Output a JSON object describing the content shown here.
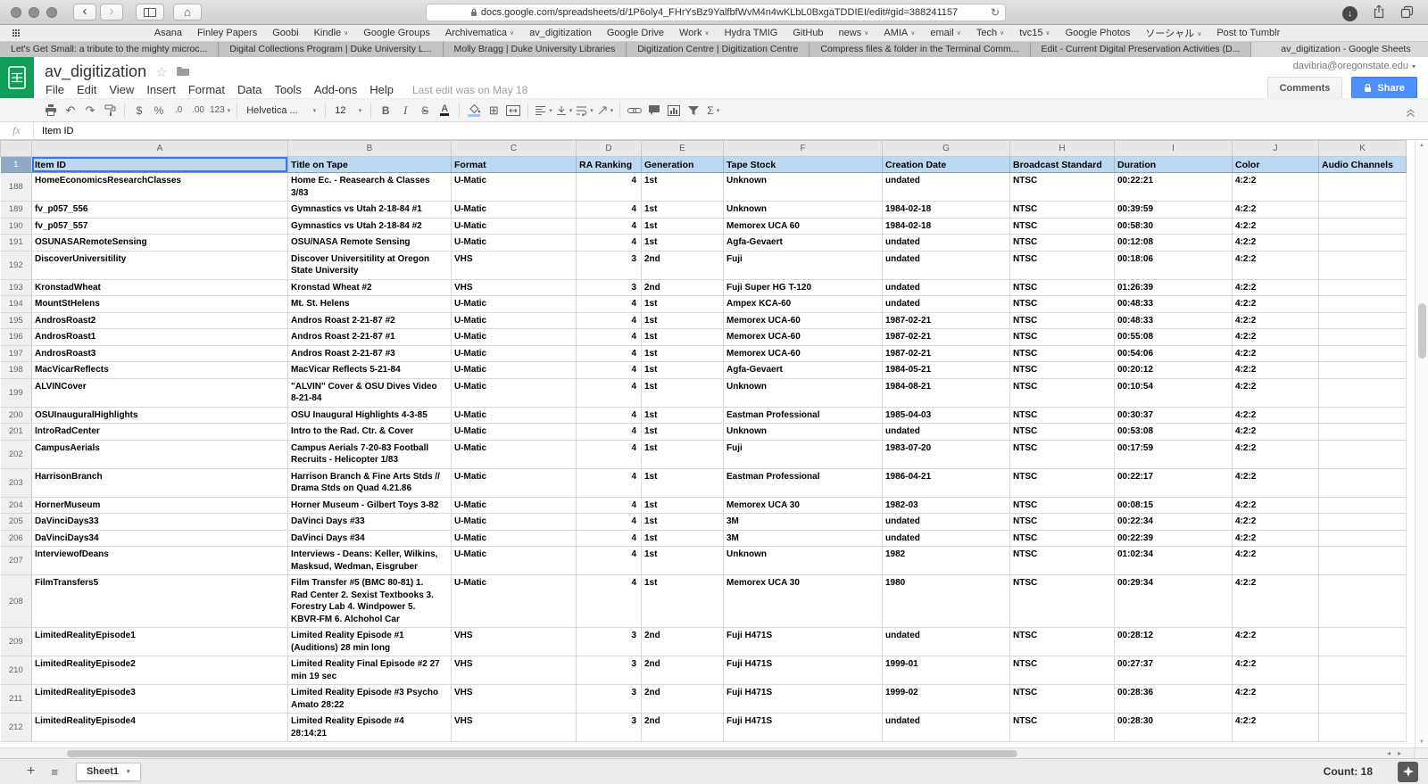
{
  "icons": {
    "back": "‹",
    "forward": "›",
    "home": "⌂",
    "refresh": "↻",
    "download_arrow": "↓",
    "undo": "↶",
    "redo": "↷",
    "borders": "⊞",
    "sigma": "Σ",
    "hamburger": "≡",
    "star_outline": "☆",
    "chevron_down": "▾",
    "bookmark_caret": "∨",
    "scroll_up": "▲",
    "scroll_down": "▼",
    "scroll_left": "◂",
    "scroll_right": "▸"
  },
  "colors": {
    "share_button": "#4d90fe",
    "sheets_green": "#0f9d58",
    "header_row_fill": "#bdd9f1",
    "selection_border": "#3b78e7"
  },
  "browser": {
    "url": "docs.google.com/spreadsheets/d/1P6oly4_FHrYsBz9YalfbfWvM4n4wKLbL0BxgaTDDIEI/edit#gid=388241157",
    "new_tab": "+",
    "bookmarks": [
      {
        "label": "Asana"
      },
      {
        "label": "Finley Papers"
      },
      {
        "label": "Goobi"
      },
      {
        "label": "Kindle",
        "dd": true
      },
      {
        "label": "Google Groups"
      },
      {
        "label": "Archivematica",
        "dd": true
      },
      {
        "label": "av_digitization"
      },
      {
        "label": "Google Drive"
      },
      {
        "label": "Work",
        "dd": true
      },
      {
        "label": "Hydra TMIG"
      },
      {
        "label": "GitHub"
      },
      {
        "label": "news",
        "dd": true
      },
      {
        "label": "AMIA",
        "dd": true
      },
      {
        "label": "email",
        "dd": true
      },
      {
        "label": "Tech",
        "dd": true
      },
      {
        "label": "tvc15",
        "dd": true
      },
      {
        "label": "Google Photos"
      },
      {
        "label": "ソーシャル",
        "dd": true
      },
      {
        "label": "Post to Tumblr"
      }
    ],
    "tabs": [
      {
        "title": "Let's Get Small: a tribute to the mighty microc...",
        "active": false
      },
      {
        "title": "Digital Collections Program | Duke University L...",
        "active": false
      },
      {
        "title": "Molly Bragg | Duke University Libraries",
        "active": false
      },
      {
        "title": "Digitization Centre | Digitization Centre",
        "active": false
      },
      {
        "title": "Compress files & folder in the Terminal Comm...",
        "active": false
      },
      {
        "title": "Edit - Current Digital Preservation Activities (D...",
        "active": false
      },
      {
        "title": "av_digitization - Google Sheets",
        "active": true
      }
    ]
  },
  "header": {
    "title": "av_digitization",
    "menus": [
      "File",
      "Edit",
      "View",
      "Insert",
      "Format",
      "Data",
      "Tools",
      "Add-ons",
      "Help"
    ],
    "last_edit": "Last edit was on May 18",
    "account": "davibria@oregonstate.edu",
    "comments": "Comments",
    "share": "Share"
  },
  "toolbar": {
    "currency": "$",
    "percent": "%",
    "decimals_decrease": ".0",
    "decimals_increase": ".00",
    "more_formats": "123",
    "font": "Helvetica ...",
    "size": "12",
    "bold": "B",
    "italic": "I",
    "strikethrough": "S",
    "text_color": "A",
    "functions": "Σ"
  },
  "formula_bar": {
    "label": "fx",
    "value": "Item ID"
  },
  "sheet": {
    "column_letters": [
      "A",
      "B",
      "C",
      "D",
      "E",
      "F",
      "G",
      "H",
      "I",
      "J",
      "K"
    ],
    "frozen_row": {
      "number": "1",
      "cells": [
        "Item ID",
        "Title on Tape",
        "Format",
        "RA Ranking",
        "Generation",
        "Tape Stock",
        "Creation Date",
        "Broadcast Standard",
        "Duration",
        "Color",
        "Audio Channels"
      ]
    },
    "rows": [
      [
        "188",
        "HomeEconomicsResearchClasses",
        "Home Ec. - Reasearch & Classes\n3/83",
        "U-Matic",
        "4",
        "1st",
        "Unknown",
        "undated",
        "NTSC",
        "00:22:21",
        "4:2:2",
        ""
      ],
      [
        "189",
        "fv_p057_556",
        "Gymnastics vs Utah 2-18-84 #1",
        "U-Matic",
        "4",
        "1st",
        "Unknown",
        "1984-02-18",
        "NTSC",
        "00:39:59",
        "4:2:2",
        ""
      ],
      [
        "190",
        "fv_p057_557",
        "Gymnastics vs Utah 2-18-84 #2",
        "U-Matic",
        "4",
        "1st",
        "Memorex UCA 60",
        "1984-02-18",
        "NTSC",
        "00:58:30",
        "4:2:2",
        ""
      ],
      [
        "191",
        "OSUNASARemoteSensing",
        "OSU/NASA Remote Sensing",
        "U-Matic",
        "4",
        "1st",
        "Agfa-Gevaert",
        "undated",
        "NTSC",
        "00:12:08",
        "4:2:2",
        ""
      ],
      [
        "192",
        "DiscoverUniversitility",
        "Discover Universitility at Oregon\nState University",
        "VHS",
        "3",
        "2nd",
        "Fuji",
        "undated",
        "NTSC",
        "00:18:06",
        "4:2:2",
        ""
      ],
      [
        "193",
        "KronstadWheat",
        "Kronstad Wheat #2",
        "VHS",
        "3",
        "2nd",
        "Fuji Super HG T-120",
        "undated",
        "NTSC",
        "01:26:39",
        "4:2:2",
        ""
      ],
      [
        "194",
        "MountStHelens",
        "Mt. St. Helens",
        "U-Matic",
        "4",
        "1st",
        "Ampex KCA-60",
        "undated",
        "NTSC",
        "00:48:33",
        "4:2:2",
        ""
      ],
      [
        "195",
        "AndrosRoast2",
        "Andros Roast 2-21-87 #2",
        "U-Matic",
        "4",
        "1st",
        "Memorex UCA-60",
        "1987-02-21",
        "NTSC",
        "00:48:33",
        "4:2:2",
        ""
      ],
      [
        "196",
        "AndrosRoast1",
        "Andros Roast 2-21-87 #1",
        "U-Matic",
        "4",
        "1st",
        "Memorex UCA-60",
        "1987-02-21",
        "NTSC",
        "00:55:08",
        "4:2:2",
        ""
      ],
      [
        "197",
        "AndrosRoast3",
        "Andros Roast 2-21-87 #3",
        "U-Matic",
        "4",
        "1st",
        "Memorex UCA-60",
        "1987-02-21",
        "NTSC",
        "00:54:06",
        "4:2:2",
        ""
      ],
      [
        "198",
        "MacVicarReflects",
        "MacVicar Reflects 5-21-84",
        "U-Matic",
        "4",
        "1st",
        "Agfa-Gevaert",
        "1984-05-21",
        "NTSC",
        "00:20:12",
        "4:2:2",
        ""
      ],
      [
        "199",
        "ALVINCover",
        "\"ALVIN\" Cover & OSU Dives Video\n8-21-84",
        "U-Matic",
        "4",
        "1st",
        "Unknown",
        "1984-08-21",
        "NTSC",
        "00:10:54",
        "4:2:2",
        ""
      ],
      [
        "200",
        "OSUInauguralHighlights",
        "OSU Inaugural Highlights 4-3-85",
        "U-Matic",
        "4",
        "1st",
        "Eastman Professional",
        "1985-04-03",
        "NTSC",
        "00:30:37",
        "4:2:2",
        ""
      ],
      [
        "201",
        "IntroRadCenter",
        "Intro to the Rad. Ctr. & Cover",
        "U-Matic",
        "4",
        "1st",
        "Unknown",
        "undated",
        "NTSC",
        "00:53:08",
        "4:2:2",
        ""
      ],
      [
        "202",
        "CampusAerials",
        "Campus Aerials 7-20-83 Football\nRecruits - Helicopter 1/83",
        "U-Matic",
        "4",
        "1st",
        "Fuji",
        "1983-07-20",
        "NTSC",
        "00:17:59",
        "4:2:2",
        ""
      ],
      [
        "203",
        "HarrisonBranch",
        "Harrison Branch & Fine Arts Stds //\nDrama Stds on Quad 4.21.86",
        "U-Matic",
        "4",
        "1st",
        "Eastman Professional",
        "1986-04-21",
        "NTSC",
        "00:22:17",
        "4:2:2",
        ""
      ],
      [
        "204",
        "HornerMuseum",
        "Horner Museum - Gilbert Toys 3-82",
        "U-Matic",
        "4",
        "1st",
        "Memorex UCA 30",
        "1982-03",
        "NTSC",
        "00:08:15",
        "4:2:2",
        ""
      ],
      [
        "205",
        "DaVinciDays33",
        "DaVinci Days #33",
        "U-Matic",
        "4",
        "1st",
        "3M",
        "undated",
        "NTSC",
        "00:22:34",
        "4:2:2",
        ""
      ],
      [
        "206",
        "DaVinciDays34",
        "DaVinci Days #34",
        "U-Matic",
        "4",
        "1st",
        "3M",
        "undated",
        "NTSC",
        "00:22:39",
        "4:2:2",
        ""
      ],
      [
        "207",
        "InterviewofDeans",
        "Interviews - Deans: Keller, Wilkins,\nMasksud, Wedman, Eisgruber",
        "U-Matic",
        "4",
        "1st",
        "Unknown",
        "1982",
        "NTSC",
        "01:02:34",
        "4:2:2",
        ""
      ],
      [
        "208",
        "FilmTransfers5",
        "Film Transfer #5 (BMC 80-81) 1.\nRad Center 2. Sexist Textbooks 3.\nForestry Lab 4. Windpower 5.\nKBVR-FM 6. Alchohol Car",
        "U-Matic",
        "4",
        "1st",
        "Memorex UCA 30",
        "1980",
        "NTSC",
        "00:29:34",
        "4:2:2",
        ""
      ],
      [
        "209",
        "LimitedRealityEpisode1",
        "Limited Reality Episode #1\n(Auditions) 28 min long",
        "VHS",
        "3",
        "2nd",
        "Fuji H471S",
        "undated",
        "NTSC",
        "00:28:12",
        "4:2:2",
        ""
      ],
      [
        "210",
        "LimitedRealityEpisode2",
        "Limited Reality Final Episode #2 27\nmin 19 sec",
        "VHS",
        "3",
        "2nd",
        "Fuji H471S",
        "1999-01",
        "NTSC",
        "00:27:37",
        "4:2:2",
        ""
      ],
      [
        "211",
        "LimitedRealityEpisode3",
        "Limited Reality Episode #3 Psycho\nAmato 28:22",
        "VHS",
        "3",
        "2nd",
        "Fuji H471S",
        "1999-02",
        "NTSC",
        "00:28:36",
        "4:2:2",
        ""
      ],
      [
        "212",
        "LimitedRealityEpisode4",
        "Limited Reality Episode #4\n28:14:21",
        "VHS",
        "3",
        "2nd",
        "Fuji H471S",
        "undated",
        "NTSC",
        "00:28:30",
        "4:2:2",
        ""
      ]
    ]
  },
  "bottom_bar": {
    "add_sheet": "+",
    "sheet_tab": "Sheet1",
    "count": "Count: 18"
  }
}
